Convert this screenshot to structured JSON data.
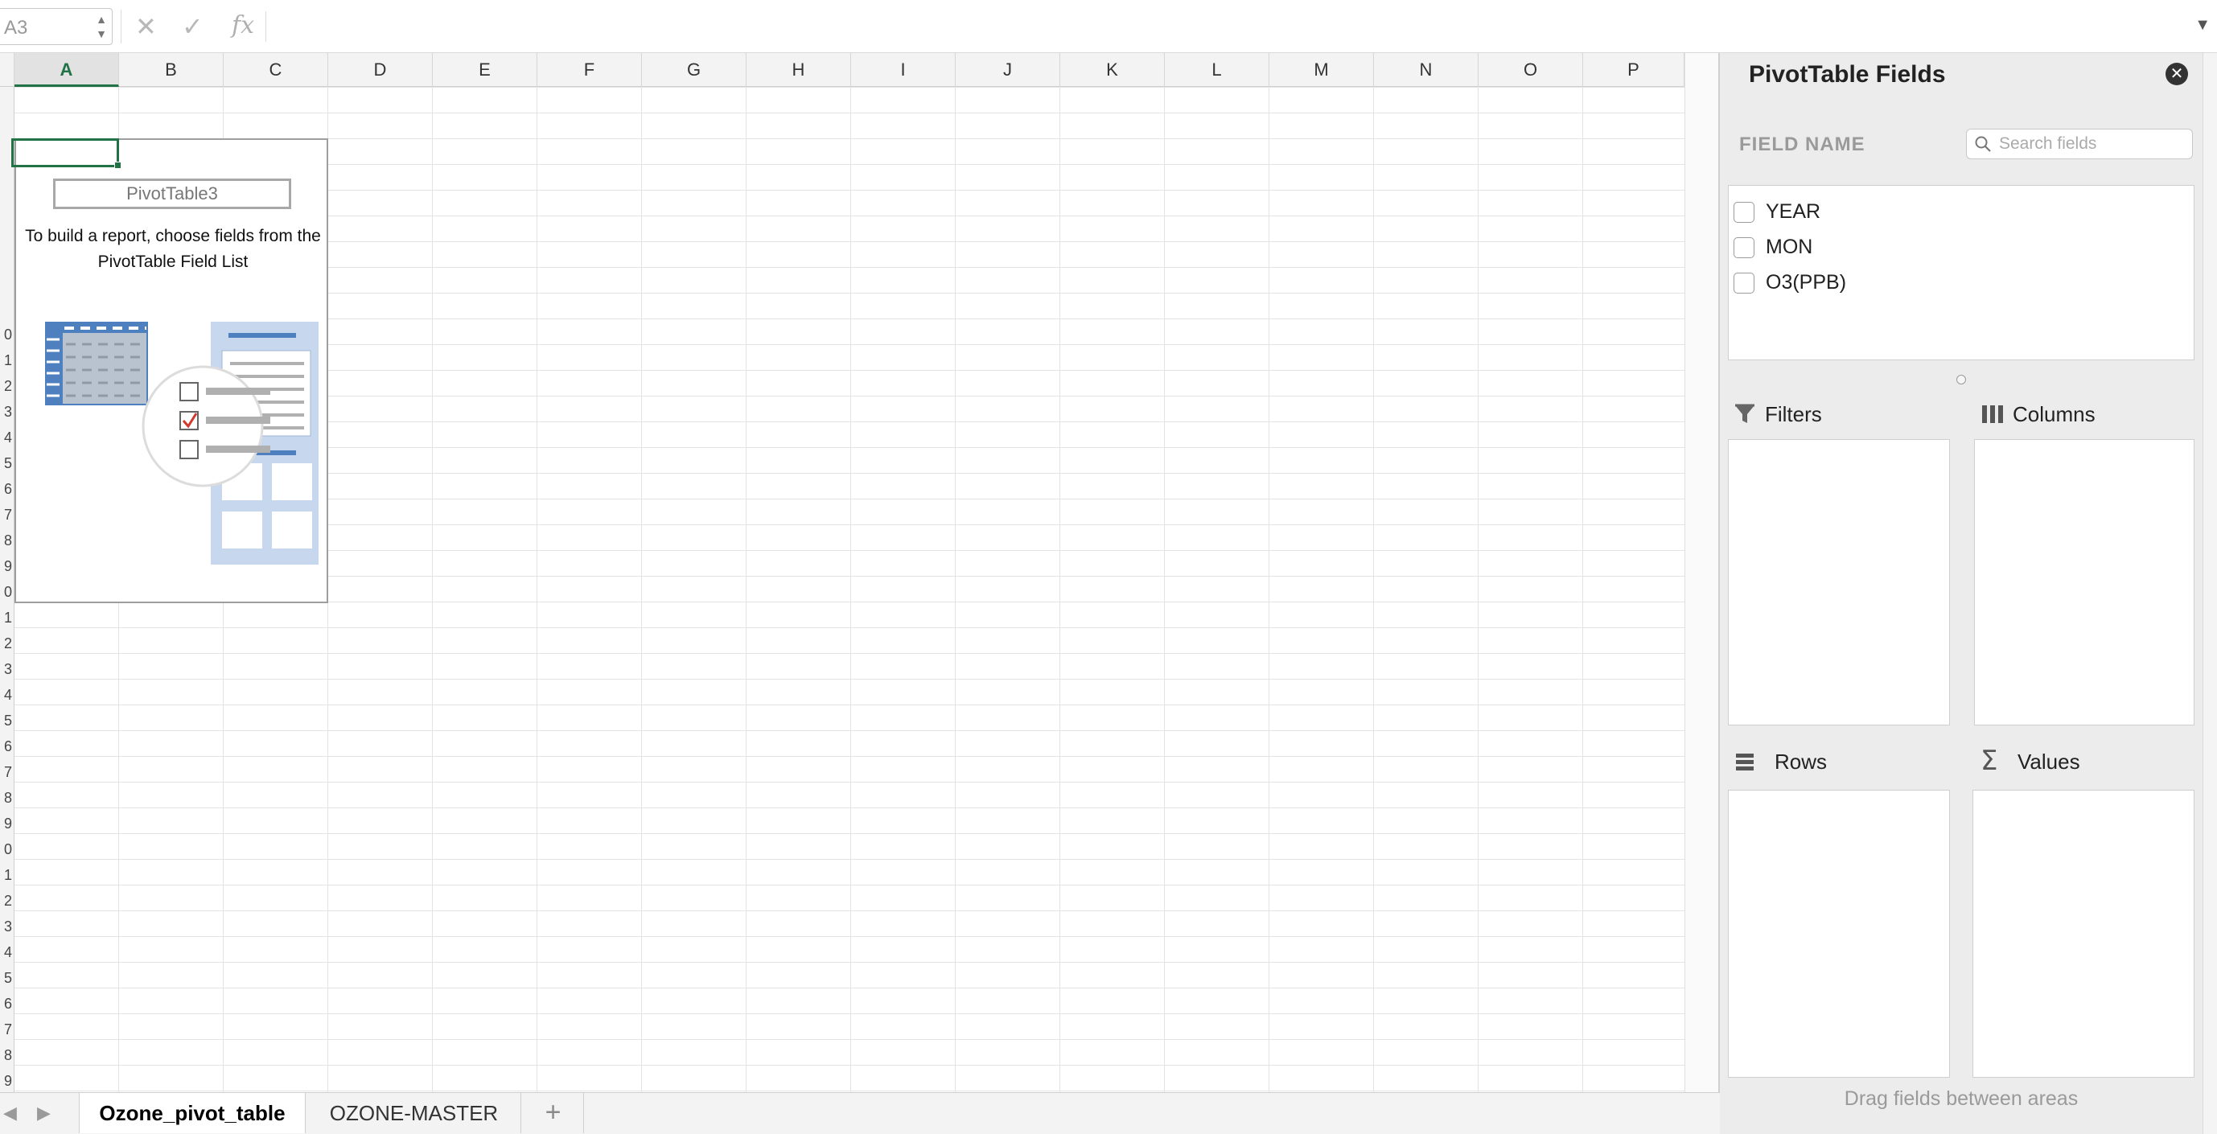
{
  "formula_bar": {
    "name_box": "A3",
    "formula": ""
  },
  "columns": [
    "A",
    "B",
    "C",
    "D",
    "E",
    "F",
    "G",
    "H",
    "I",
    "J",
    "K",
    "L",
    "M",
    "N",
    "O",
    "P"
  ],
  "row_labels": [
    "0",
    "1",
    "2",
    "3",
    "4",
    "5",
    "6",
    "7",
    "8",
    "9",
    "0",
    "1",
    "2",
    "3",
    "4",
    "5",
    "6",
    "7",
    "8",
    "9",
    "0",
    "1",
    "2",
    "3",
    "4",
    "5",
    "6",
    "7",
    "8",
    "9"
  ],
  "pivot_placeholder": {
    "name": "PivotTable3",
    "instructions": "To build a report, choose fields from the PivotTable Field List"
  },
  "pivot_pane": {
    "title": "PivotTable Fields",
    "field_name_label": "FIELD NAME",
    "search_placeholder": "Search fields",
    "fields": [
      {
        "label": "YEAR",
        "checked": false
      },
      {
        "label": "MON",
        "checked": false
      },
      {
        "label": "O3(PPB)",
        "checked": false
      }
    ],
    "areas": {
      "filters": "Filters",
      "columns": "Columns",
      "rows": "Rows",
      "values": "Values"
    },
    "footer": "Drag fields between areas"
  },
  "sheet_tabs": {
    "active": "Ozone_pivot_table",
    "other": "OZONE-MASTER"
  },
  "colors": {
    "accent": "#217346",
    "pivot_blue": "#4e7fbf",
    "pivot_light_blue": "#c7d8ee"
  }
}
